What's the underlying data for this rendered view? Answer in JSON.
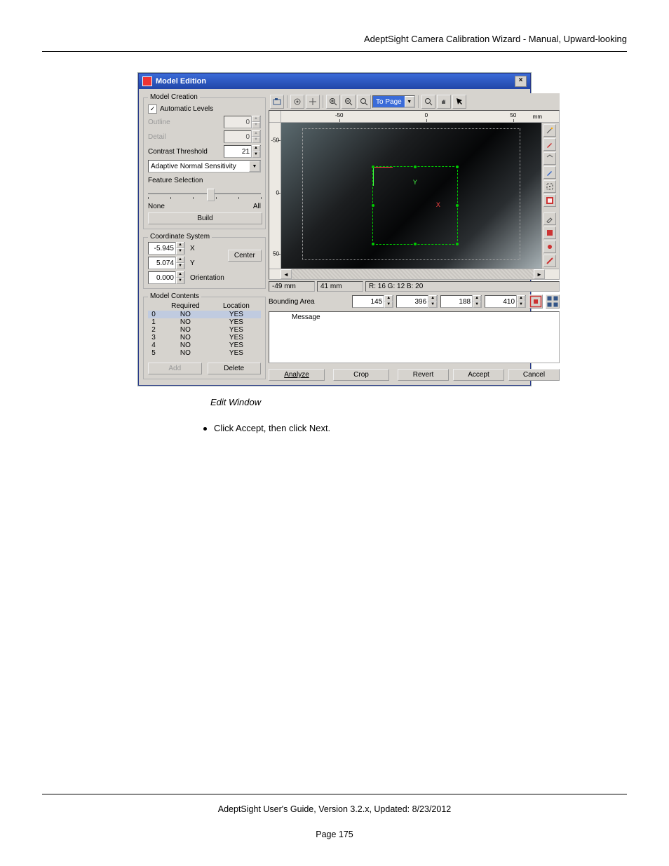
{
  "doc": {
    "header": "AdeptSight Camera Calibration Wizard - Manual, Upward-looking",
    "caption": "Edit Window",
    "instruction": "Click Accept, then click Next.",
    "footer_line": "AdeptSight User's Guide,  Version 3.2.x, Updated: 8/23/2012",
    "page_num": "Page 175"
  },
  "win": {
    "title": "Model Edition",
    "close": "×"
  },
  "model_creation": {
    "title": "Model Creation",
    "auto_levels": "Automatic Levels",
    "outline": "Outline",
    "outline_val": "0",
    "detail": "Detail",
    "detail_val": "0",
    "contrast": "Contrast Threshold",
    "contrast_val": "21",
    "sensitivity": "Adaptive Normal Sensitivity",
    "feature": "Feature Selection",
    "none": "None",
    "all": "All",
    "build": "Build"
  },
  "coord": {
    "title": "Coordinate System",
    "x": "-5.945",
    "xlab": "X",
    "y": "5.074",
    "ylab": "Y",
    "o": "0.000",
    "olab": "Orientation",
    "center": "Center"
  },
  "contents": {
    "title": "Model Contents",
    "h_req": "Required",
    "h_loc": "Location",
    "rows": [
      {
        "i": "0",
        "r": "NO",
        "l": "YES"
      },
      {
        "i": "1",
        "r": "NO",
        "l": "YES"
      },
      {
        "i": "2",
        "r": "NO",
        "l": "YES"
      },
      {
        "i": "3",
        "r": "NO",
        "l": "YES"
      },
      {
        "i": "4",
        "r": "NO",
        "l": "YES"
      },
      {
        "i": "5",
        "r": "NO",
        "l": "YES"
      }
    ],
    "add": "Add",
    "delete": "Delete"
  },
  "viewer": {
    "zoom": "To Page",
    "unit": "mm",
    "ruler_h": [
      {
        "v": "-50",
        "p": 22
      },
      {
        "v": "0",
        "p": 55
      },
      {
        "v": "50",
        "p": 88
      }
    ],
    "ruler_v": [
      {
        "v": "-50",
        "p": 12
      },
      {
        "v": "0",
        "p": 48
      },
      {
        "v": "50",
        "p": 90
      }
    ],
    "axis_x": "X",
    "axis_y": "Y",
    "status_x": "-49 mm",
    "status_y": "41 mm",
    "status_rgb": "R: 16 G: 12 B: 20",
    "bounding": "Bounding Area",
    "b1": "145",
    "b2": "396",
    "b3": "188",
    "b4": "410"
  },
  "msg": {
    "header": "Message"
  },
  "actions": {
    "analyze": "Analyze",
    "crop": "Crop",
    "revert": "Revert",
    "accept": "Accept",
    "cancel": "Cancel"
  }
}
